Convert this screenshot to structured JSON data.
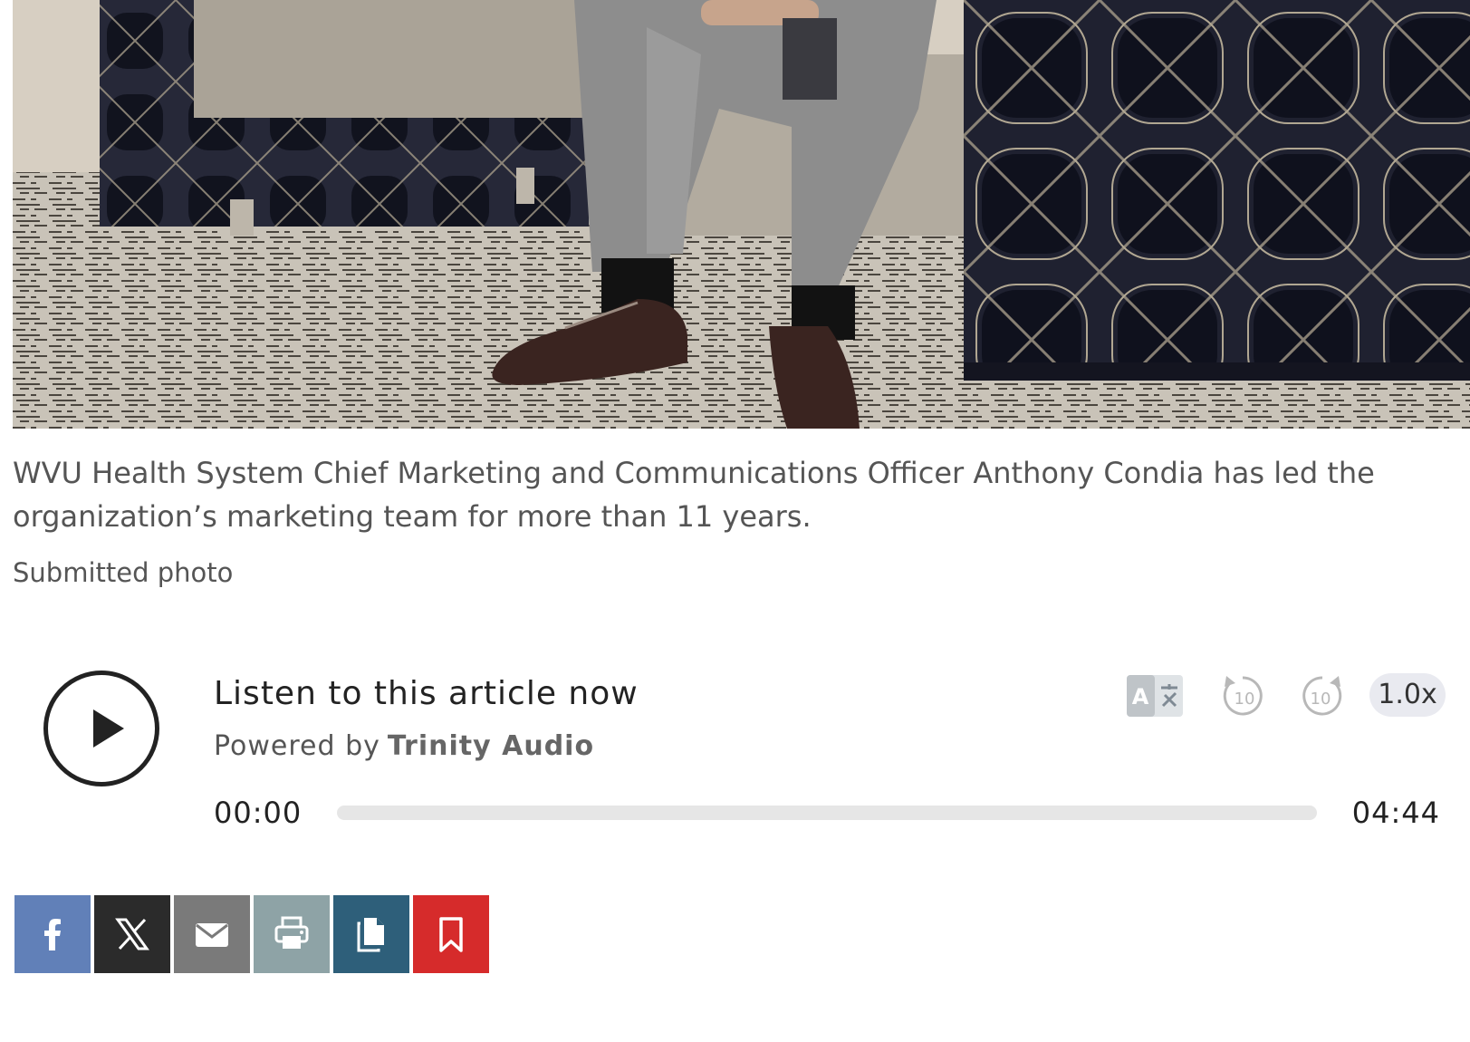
{
  "caption": {
    "text": "WVU Health System Chief Marketing and Communications Officer Anthony Condia has led the organization’s marketing team for more than 11 years.",
    "credit": "Submitted photo"
  },
  "audio_player": {
    "title": "Listen to this article now",
    "powered_by_label": "Powered by",
    "powered_by_brand": "Trinity Audio",
    "current_time": "00:00",
    "total_time": "04:44",
    "progress": 0,
    "translate_icon": "translate-icon",
    "rewind_label": "10",
    "forward_label": "10",
    "speed": "1.0x"
  },
  "share": {
    "buttons": [
      {
        "name": "facebook",
        "icon": "facebook-icon",
        "color": "#6180b8"
      },
      {
        "name": "x",
        "icon": "x-icon",
        "color": "#2b2b2b"
      },
      {
        "name": "email",
        "icon": "envelope-icon",
        "color": "#7a7a7a"
      },
      {
        "name": "print",
        "icon": "printer-icon",
        "color": "#8ea3a6"
      },
      {
        "name": "copy",
        "icon": "copy-icon",
        "color": "#2e5f7a"
      },
      {
        "name": "bookmark",
        "icon": "bookmark-icon",
        "color": "#d62b2b"
      }
    ]
  }
}
